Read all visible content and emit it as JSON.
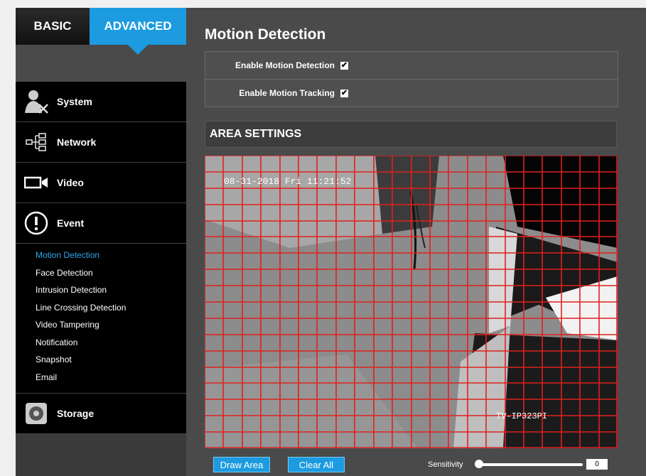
{
  "tabs": {
    "basic": "BASIC",
    "advanced": "ADVANCED"
  },
  "nav": {
    "system": "System",
    "network": "Network",
    "video": "Video",
    "event": "Event",
    "storage": "Storage",
    "event_items": [
      "Motion Detection",
      "Face Detection",
      "Intrusion Detection",
      "Line Crossing Detection",
      "Video Tampering",
      "Notification",
      "Snapshot",
      "Email"
    ]
  },
  "page": {
    "title": "Motion Detection",
    "enable_motion_label": "Enable Motion Detection",
    "enable_motion_checked": true,
    "enable_tracking_label": "Enable Motion Tracking",
    "enable_tracking_checked": true,
    "area_header": "AREA SETTINGS"
  },
  "video": {
    "timestamp": "08-31-2018 Fri 11:21:52",
    "camera_name": "TV-IP323PI",
    "grid_cols": 22,
    "grid_rows": 18,
    "grid_color": "#e02020"
  },
  "controls": {
    "draw_area": "Draw Area",
    "clear_all": "Clear All",
    "sensitivity_label": "Sensitivity",
    "sensitivity_value": "0"
  },
  "colors": {
    "accent": "#1c9be0",
    "selected_sub": "#2ea6ea"
  }
}
